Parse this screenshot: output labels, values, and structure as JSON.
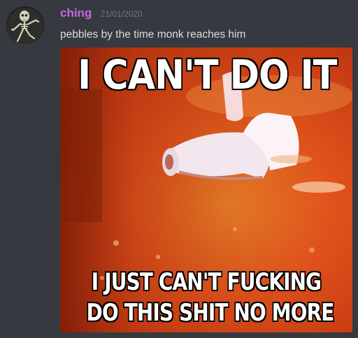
{
  "message": {
    "author": "ching",
    "timestamp": "21/01/2020",
    "text": "pebbles by the time monk reaches him",
    "author_color": "#c36ae0"
  },
  "attachment": {
    "caption_top": "I CAN'T DO IT",
    "caption_bottom_line1": "I JUST CAN'T FUCKING",
    "caption_bottom_line2": "DO THIS SHIT NO MORE"
  },
  "theme": {
    "background": "#36393f",
    "text": "#dcddde",
    "muted": "#72767d"
  },
  "icons": {
    "avatar": "skeleton-avatar-icon"
  }
}
